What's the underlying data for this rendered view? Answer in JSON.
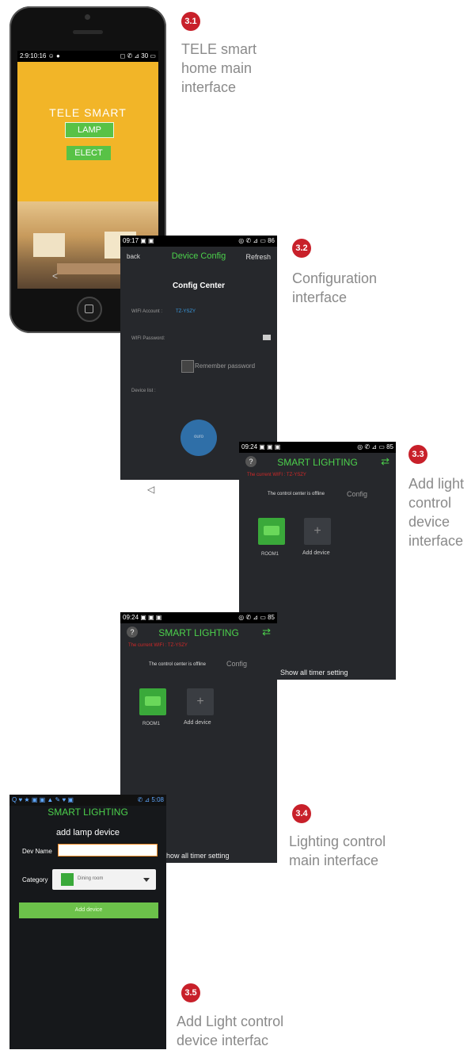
{
  "steps": [
    {
      "number": "3.1",
      "caption": "TELE smart home main interface"
    },
    {
      "number": "3.2",
      "caption": "Configuration interface"
    },
    {
      "number": "3.3",
      "caption": "Add light control device interface"
    },
    {
      "number": "3.4",
      "caption": "Lighting control main interface"
    },
    {
      "number": "3.5",
      "caption": "Add Light control device interfac"
    }
  ],
  "screen1": {
    "status_left": "2:9:10:16 ☺ ●",
    "status_right": "◻ ✆ ⊿ 30 ▭",
    "title": "TELE SMART",
    "btn1": "LAMP",
    "btn2": "ELECT",
    "back_glyph": "<",
    "home_glyph": "□"
  },
  "screen2": {
    "status_left": "09:17 ▣ ▣",
    "status_right": "◎ ✆ ⊿ ▭ 86",
    "back": "back",
    "title": "Device Config",
    "refresh": "Refresh",
    "center_title": "Config Center",
    "wifi_account_label": "WIFI Account :",
    "wifi_account_value": "TZ-YSZY",
    "wifi_password_label": "WIFI Password:",
    "remember": "Remember password",
    "device_list": "Device list :",
    "circle_label": "ouro",
    "nav_back": "◁"
  },
  "screen3": {
    "status_left": "09:24 ▣ ▣ ▣",
    "status_right": "◎ ✆ ⊿ ▭ 85",
    "help": "?",
    "title": "SMART LIGHTING",
    "refresh_glyph": "⇄",
    "wifi_line": "The current WIFI : TZ-YSZY",
    "offline": "The control center is offline",
    "config": "Config",
    "room": "ROOM1",
    "add_device": "Add device",
    "plus": "+",
    "timer": "Show all timer setting"
  },
  "screen4": {
    "status_left": "09:24 ▣ ▣ ▣",
    "status_right": "◎ ✆ ⊿ ▭ 85",
    "help": "?",
    "title": "SMART LIGHTING",
    "refresh_glyph": "⇄",
    "wifi_line": "The current WIFI : TZ-YSZY",
    "offline": "The control center is offline",
    "config": "Config",
    "room": "ROOM1",
    "add_device": "Add device",
    "plus": "+",
    "timer": "how all timer setting"
  },
  "screen5": {
    "status_left": "Q ♥ ★ ▣ ▣ ▲ ✎ ♥ ▣",
    "status_right": "✆ ⊿ 5:08",
    "title": "SMART LIGHTING",
    "heading": "add lamp device",
    "dev_name_label": "Dev Name",
    "dev_name_value": "",
    "category_label": "Category",
    "category_value": "Dining room",
    "add_button": "Add device",
    "colors": {
      "green": "#3aa93a",
      "accent": "#f08c28"
    }
  },
  "colors": {
    "badge": "#c8202a",
    "caption": "#8a8a8a",
    "app_green": "#4cd14c",
    "wifi_red": "#d02828",
    "wifi_blue": "#3a9ae0"
  }
}
